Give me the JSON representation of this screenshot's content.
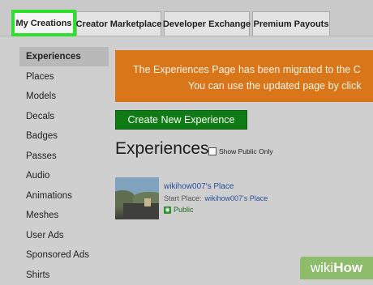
{
  "tabs": [
    {
      "label": "My Creations",
      "active": true
    },
    {
      "label": "Creator Marketplace",
      "active": false
    },
    {
      "label": "Developer Exchange",
      "active": false
    },
    {
      "label": "Premium Payouts",
      "active": false
    }
  ],
  "sidebar": {
    "items": [
      {
        "label": "Experiences",
        "active": true
      },
      {
        "label": "Places"
      },
      {
        "label": "Models"
      },
      {
        "label": "Decals"
      },
      {
        "label": "Badges"
      },
      {
        "label": "Passes"
      },
      {
        "label": "Audio"
      },
      {
        "label": "Animations"
      },
      {
        "label": "Meshes"
      },
      {
        "label": "User Ads"
      },
      {
        "label": "Sponsored Ads"
      },
      {
        "label": "Shirts"
      }
    ]
  },
  "banner": {
    "line1": "The Experiences Page has been migrated to the C",
    "line2": "You can use the updated page by click",
    "color": "#d9761a"
  },
  "create_button": {
    "label": "Create New Experience",
    "color": "#0f7b14"
  },
  "page_title": "Experiences",
  "show_public": {
    "label": "Show Public Only",
    "checked": false
  },
  "places": [
    {
      "name": "wikihow007's Place",
      "start_place_label": "Start Place:",
      "start_place_value": "wikihow007's Place",
      "status": "Public",
      "status_icon": "globe-icon"
    }
  ],
  "watermark": {
    "wiki": "wiki",
    "how": "How"
  },
  "colors": {
    "active_tab_highlight": "#2ee02e",
    "link": "#2a4f98",
    "background": "#cfcfcf"
  }
}
